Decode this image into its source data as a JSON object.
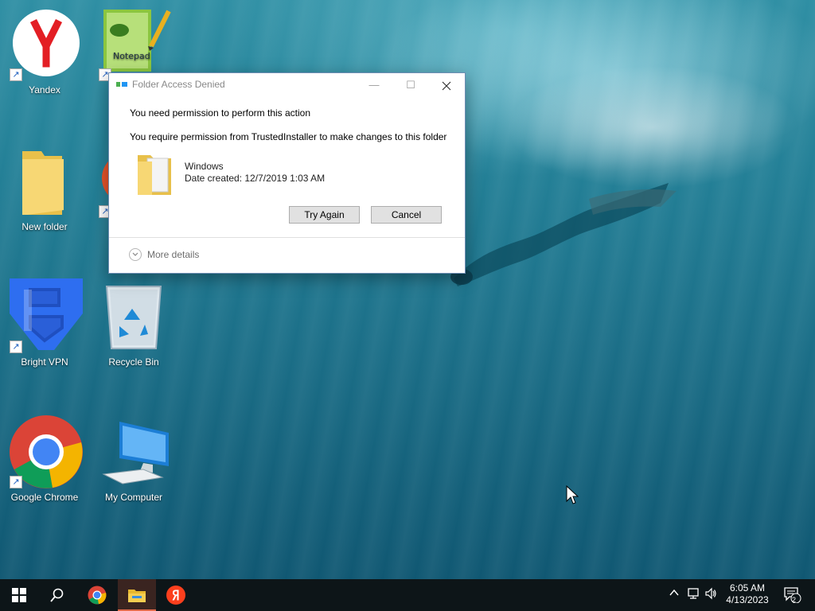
{
  "desktop": {
    "icons": [
      {
        "label": "Yandex",
        "icon": "yandex-icon"
      },
      {
        "label": "",
        "icon": "notepad-plus-plus-icon"
      },
      {
        "label": "New folder",
        "icon": "folder-icon"
      },
      {
        "label": "",
        "icon": "firefox-icon"
      },
      {
        "label": "Bright VPN",
        "icon": "bright-vpn-icon"
      },
      {
        "label": "Recycle Bin",
        "icon": "recycle-bin-icon"
      },
      {
        "label": "Google Chrome",
        "icon": "chrome-icon"
      },
      {
        "label": "My Computer",
        "icon": "computer-icon"
      }
    ]
  },
  "dialog": {
    "title": "Folder Access Denied",
    "line1": "You need permission to perform this action",
    "line2": "You require permission from TrustedInstaller to make changes to this folder",
    "folder_name": "Windows",
    "folder_date": "Date created: 12/7/2019 1:03 AM",
    "try_again": "Try Again",
    "cancel": "Cancel",
    "more_details": "More details"
  },
  "taskbar": {
    "time": "6:05 AM",
    "date": "4/13/2023",
    "notification_count": "2",
    "apps": [
      "start-icon",
      "search-icon",
      "chrome-icon",
      "file-explorer-icon",
      "yandex-icon"
    ]
  },
  "colors": {
    "taskbar": "#0d1518",
    "active_indicator": "#e06a4a",
    "dialog_border": "#6e8db3"
  }
}
